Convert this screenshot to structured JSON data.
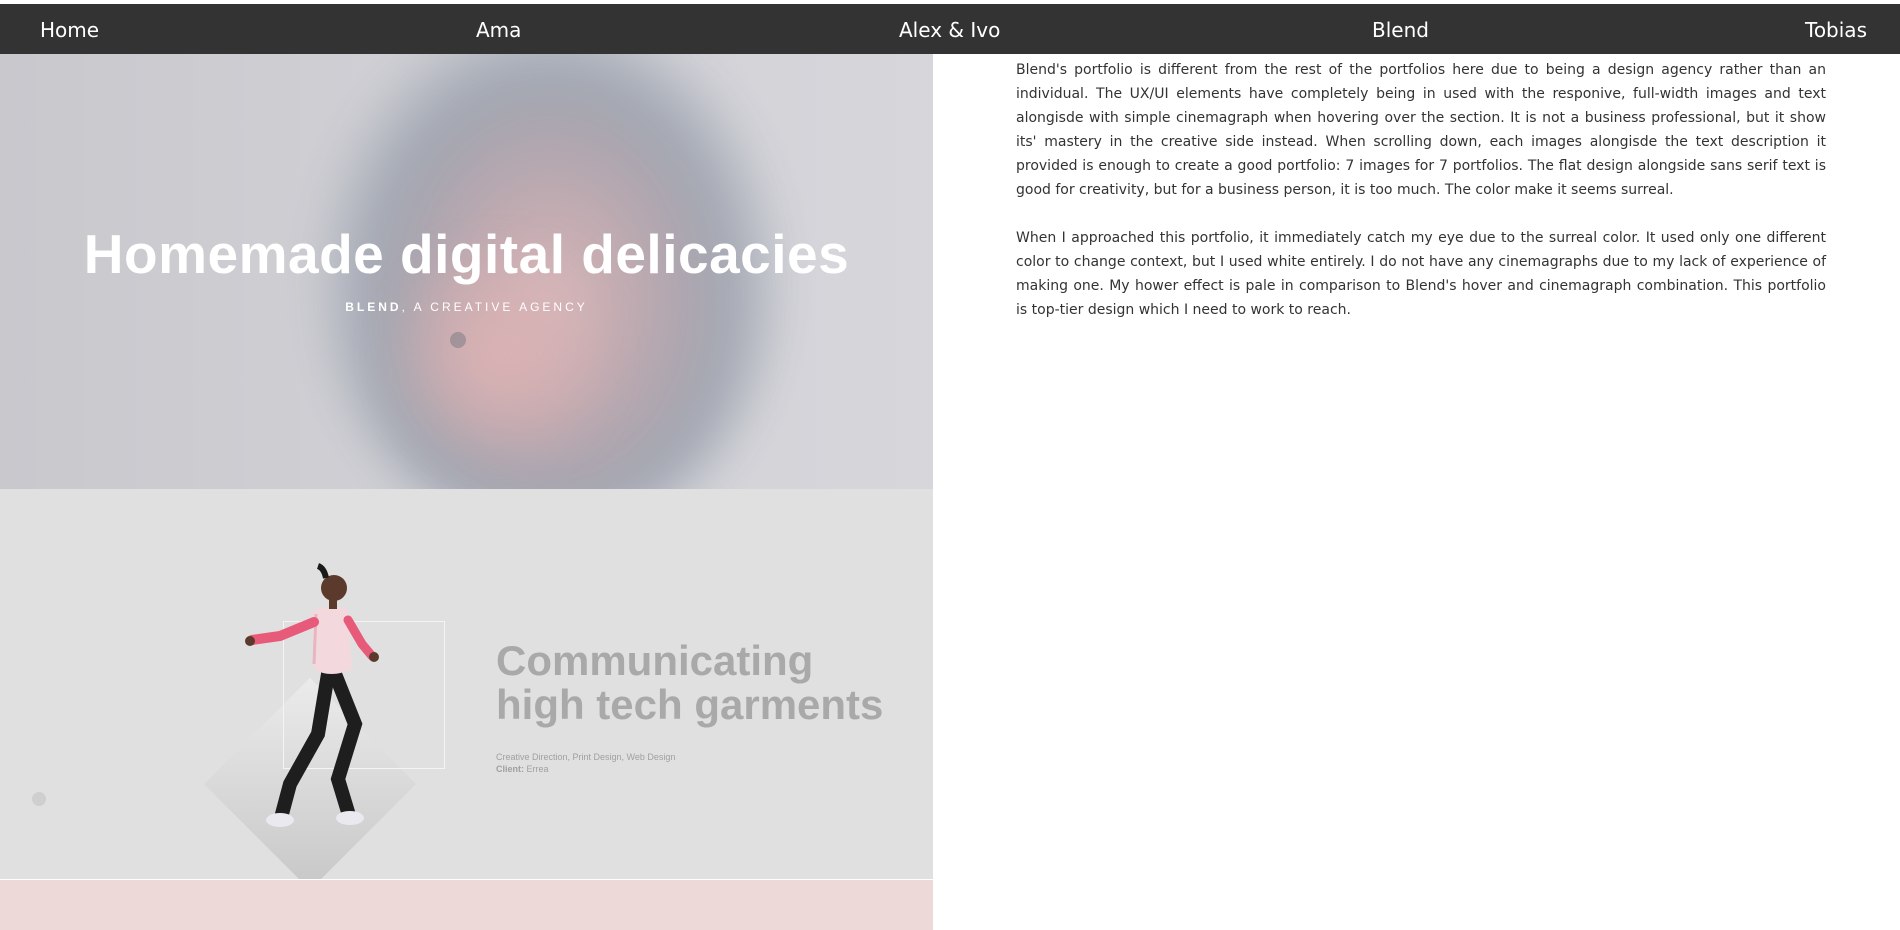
{
  "nav": {
    "items": [
      "Home",
      "Ama",
      "Alex & Ivo",
      "Blend",
      "Tobias"
    ]
  },
  "hero": {
    "title": "Homemade digital delicacies",
    "subtitle_bold": "BLEND",
    "subtitle_rest": ", A CREATIVE AGENCY"
  },
  "garment": {
    "title_line1": "Communicating",
    "title_line2": "high tech garments",
    "services": "Creative Direction, Print Design, Web Design",
    "client_label": "Client:",
    "client_value": "Errea"
  },
  "article": {
    "p1": "Blend's portfolio is different from the rest of the portfolios here due to being a design agency rather than an individual. The UX/UI elements have completely being in used with the responive, full-width images and text alongisde with simple cinemagraph when hovering over the section. It is not a business professional, but it show its' mastery in the creative side instead. When scrolling down, each images alongisde the text description it provided is enough to create a good portfolio: 7 images for 7 portfolios. The flat design alongside sans serif text is good for creativity, but for a business person, it is too much. The color make it seems surreal.",
    "p2": "When I approached this portfolio, it immediately catch my eye due to the surreal color. It used only one different color to change context, but I used white entirely. I do not have any cinemagraphs due to my lack of experience of making one. My hower effect is pale in comparison to Blend's hover and cinemagraph combination. This portfolio is top-tier design which I need to work to reach."
  },
  "colors": {
    "nav_bg": "#333333",
    "nav_text": "#ffffff",
    "hero_bg": "#cfcfd4",
    "garment_bg": "#e0e0e0",
    "pink_bg": "#eed9d9",
    "body_text": "#333333"
  }
}
